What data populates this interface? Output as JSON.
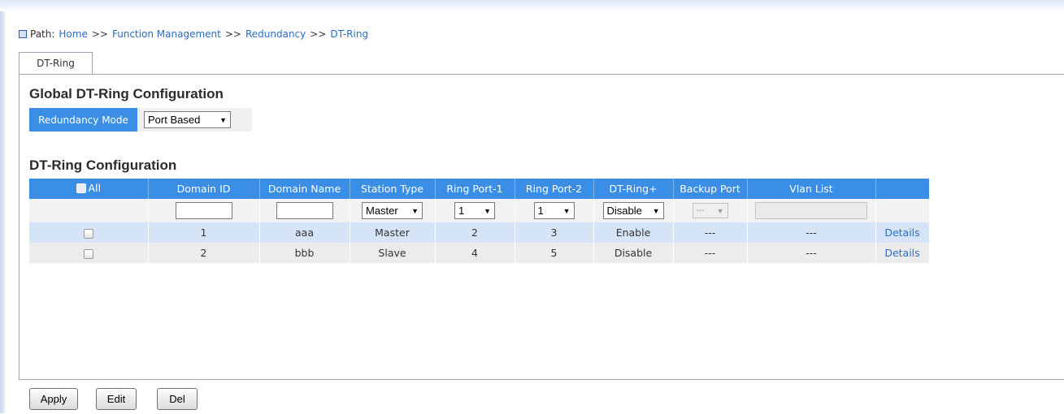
{
  "path": {
    "label": "Path:",
    "items": [
      "Home",
      "Function Management",
      "Redundancy",
      "DT-Ring"
    ],
    "separator": ">>"
  },
  "tab": {
    "label": "DT-Ring"
  },
  "global": {
    "title": "Global DT-Ring Configuration",
    "mode_label": "Redundancy Mode",
    "mode_value": "Port Based"
  },
  "config": {
    "title": "DT-Ring Configuration",
    "columns": [
      "All",
      "Domain ID",
      "Domain Name",
      "Station Type",
      "Ring Port-1",
      "Ring Port-2",
      "DT-Ring+",
      "Backup Port",
      "Vlan List"
    ],
    "input_row": {
      "station_type": "Master",
      "ring_port_1": "1",
      "ring_port_2": "1",
      "dt_ring_plus": "Disable",
      "backup_port": "---"
    },
    "rows": [
      {
        "domain_id": "1",
        "domain_name": "aaa",
        "station_type": "Master",
        "ring_port_1": "2",
        "ring_port_2": "3",
        "dt_ring_plus": "Enable",
        "backup_port": "---",
        "vlan_list": "---",
        "action": "Details"
      },
      {
        "domain_id": "2",
        "domain_name": "bbb",
        "station_type": "Slave",
        "ring_port_1": "4",
        "ring_port_2": "5",
        "dt_ring_plus": "Disable",
        "backup_port": "---",
        "vlan_list": "---",
        "action": "Details"
      }
    ]
  },
  "buttons": {
    "apply": "Apply",
    "edit": "Edit",
    "del": "Del"
  },
  "colors": {
    "header_blue": "#3a8ee6",
    "link": "#2a6dc4",
    "row_highlight": "#d6e4f7"
  }
}
